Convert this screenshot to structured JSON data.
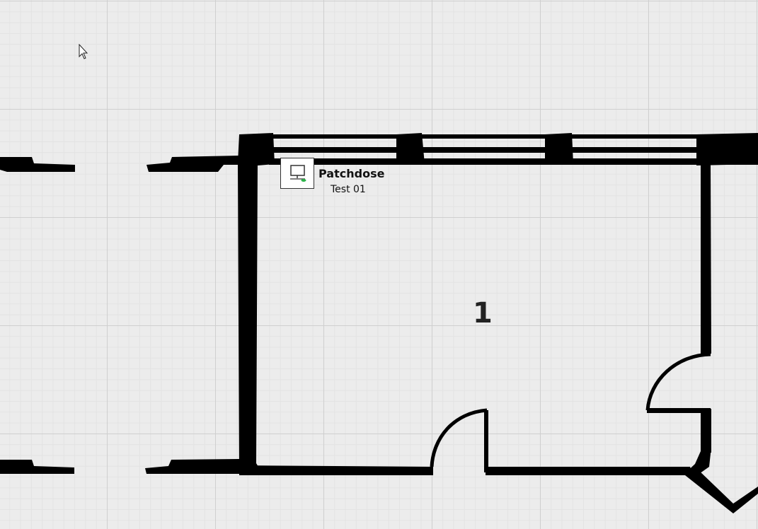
{
  "device": {
    "name": "Patchdose",
    "description": "Test 01",
    "icon": "computer-network-icon"
  },
  "room": {
    "number": "1"
  },
  "colors": {
    "wall": "#000000",
    "grid_major": "#cfcfcf",
    "grid_minor": "#e3e3e3",
    "background": "#ececec",
    "network_accent": "#2db34a"
  }
}
